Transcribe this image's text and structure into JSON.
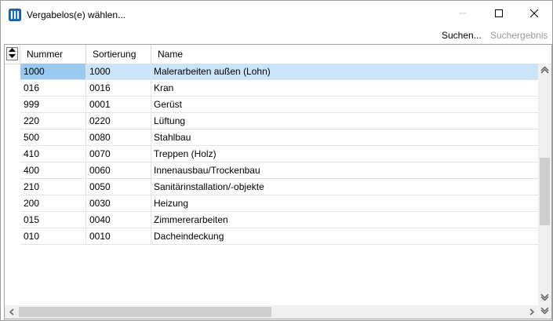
{
  "window": {
    "title": "Vergabelos(e) wählen...",
    "accent": "#1f6fc5"
  },
  "toolbar": {
    "search_label": "Suchen...",
    "result_label": "Suchergebnis"
  },
  "grid": {
    "columns": [
      "Nummer",
      "Sortierung",
      "Name"
    ],
    "selected_index": 0,
    "rows": [
      {
        "nummer": "1000",
        "sortierung": "1000",
        "name": "Malerarbeiten außen (Lohn)"
      },
      {
        "nummer": "016",
        "sortierung": "0016",
        "name": "Kran"
      },
      {
        "nummer": "999",
        "sortierung": "0001",
        "name": "Gerüst"
      },
      {
        "nummer": "220",
        "sortierung": "0220",
        "name": "Lüftung"
      },
      {
        "nummer": "500",
        "sortierung": "0080",
        "name": "Stahlbau"
      },
      {
        "nummer": "410",
        "sortierung": "0070",
        "name": "Treppen (Holz)"
      },
      {
        "nummer": "400",
        "sortierung": "0060",
        "name": "Innenausbau/Trockenbau"
      },
      {
        "nummer": "210",
        "sortierung": "0050",
        "name": "Sanitärinstallation/-objekte"
      },
      {
        "nummer": "200",
        "sortierung": "0030",
        "name": "Heizung"
      },
      {
        "nummer": "015",
        "sortierung": "0040",
        "name": "Zimmererarbeiten"
      },
      {
        "nummer": "010",
        "sortierung": "0010",
        "name": "Dacheindeckung"
      }
    ]
  },
  "icons": {
    "app": "app-grid-icon",
    "minimize": "minimize-icon",
    "maximize": "maximize-icon",
    "close": "close-icon",
    "sort": "sort-updown-icon"
  }
}
